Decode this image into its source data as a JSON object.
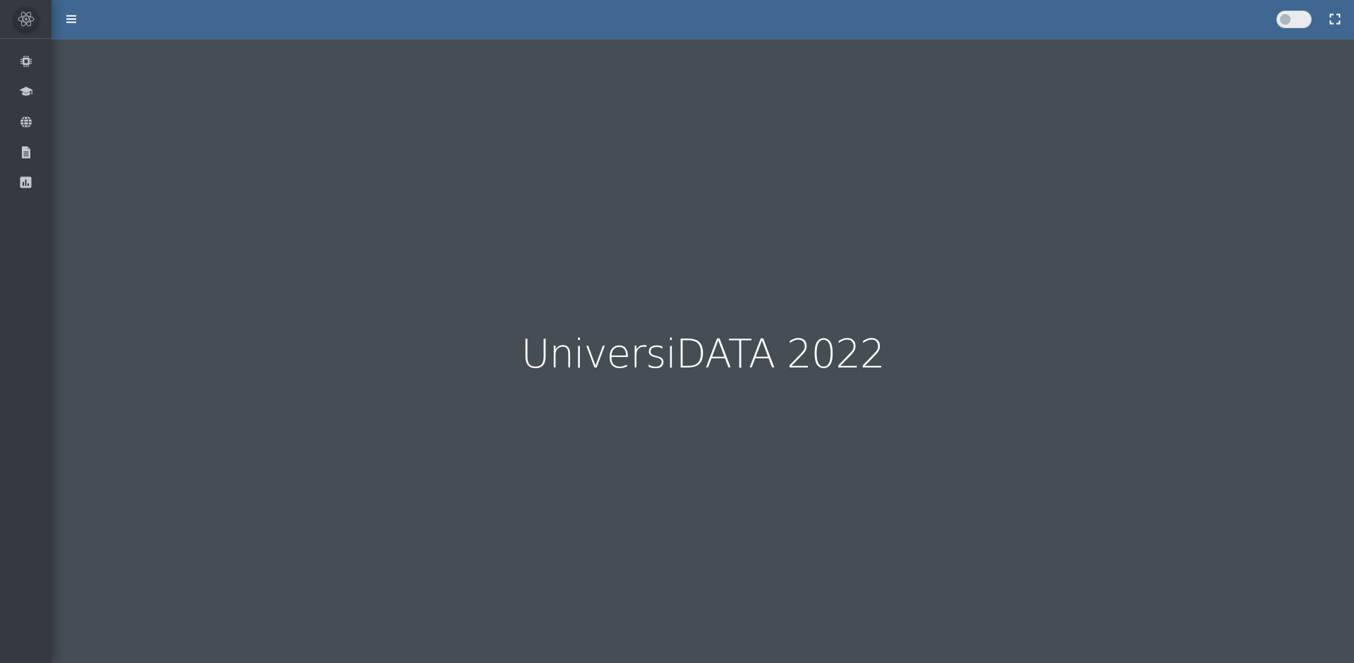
{
  "app": {
    "colors": {
      "sidebar": "#343a40",
      "navbar": "#3f6791",
      "content": "#454d55",
      "icon": "#c2c7d0",
      "text": "#ffffff"
    }
  },
  "sidebar": {
    "logo_icon": "atom-icon",
    "items": [
      {
        "icon": "cpu-chip-icon"
      },
      {
        "icon": "graduation-cap-icon"
      },
      {
        "icon": "globe-icon"
      },
      {
        "icon": "document-icon"
      },
      {
        "icon": "bar-chart-icon"
      }
    ]
  },
  "navbar": {
    "menu_icon": "hamburger-menu-icon",
    "theme_toggle_icon": "toggle-switch-icon",
    "fullscreen_icon": "expand-icon"
  },
  "main": {
    "title": "UniversiDATA 2022"
  }
}
